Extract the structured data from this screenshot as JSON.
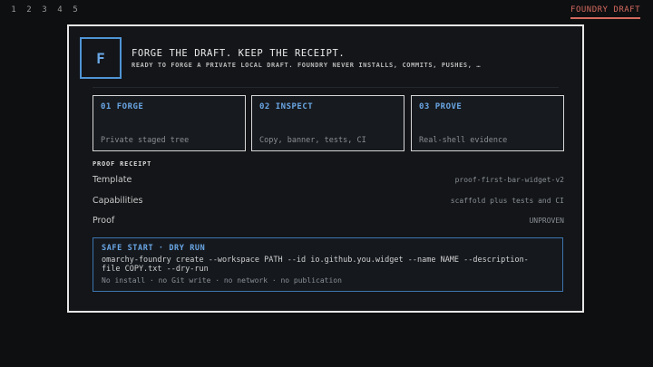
{
  "topbar": {
    "workspaces": [
      "1",
      "2",
      "3",
      "4",
      "5"
    ],
    "app_title": "FOUNDRY DRAFT"
  },
  "header": {
    "logo_letter": "F",
    "title": "FORGE THE DRAFT. KEEP THE RECEIPT.",
    "subtitle": "READY TO FORGE A PRIVATE LOCAL DRAFT. FOUNDRY NEVER INSTALLS, COMMITS, PUSHES, …"
  },
  "steps": [
    {
      "title": "01  FORGE",
      "desc": "Private staged tree"
    },
    {
      "title": "02  INSPECT",
      "desc": "Copy, banner, tests, CI"
    },
    {
      "title": "03  PROVE",
      "desc": "Real-shell evidence"
    }
  ],
  "receipt": {
    "label": "PROOF RECEIPT",
    "rows": [
      {
        "key": "Template",
        "value": "proof-first-bar-widget-v2"
      },
      {
        "key": "Capabilities",
        "value": "scaffold plus tests and CI"
      },
      {
        "key": "Proof",
        "value": "UNPROVEN"
      }
    ]
  },
  "command": {
    "heading": "SAFE START · DRY RUN",
    "text": "omarchy-foundry create --workspace PATH --id io.github.you.widget --name NAME --description-file COPY.txt --dry-run",
    "footer": "No install · no Git write · no network · no publication"
  },
  "colors": {
    "accent": "#6aa7e6",
    "app_title": "#d46a5e",
    "background": "#0e0f11"
  }
}
